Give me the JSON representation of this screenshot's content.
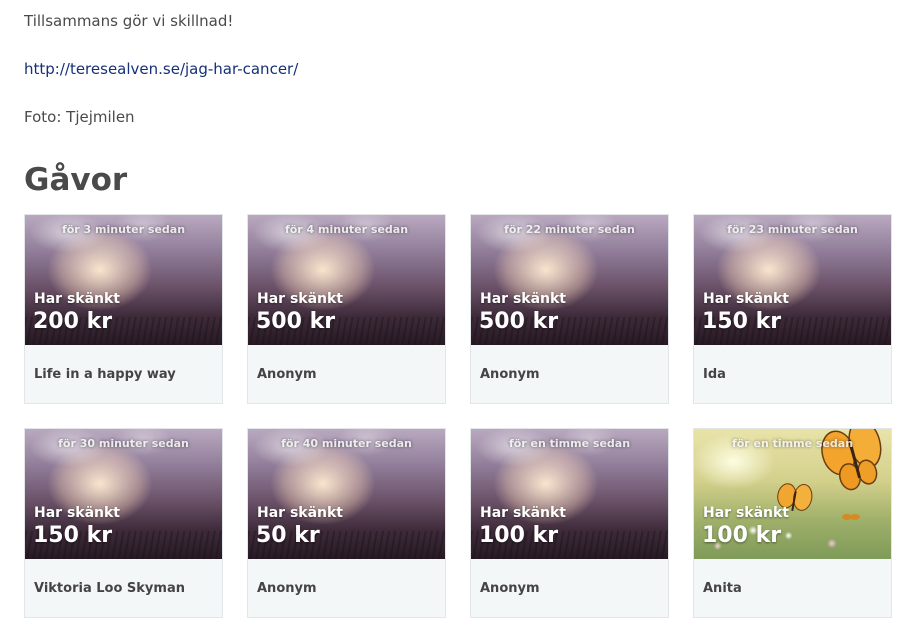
{
  "intro": {
    "tagline": "Tillsammans gör vi skillnad!",
    "link": "http://teresealven.se/jag-har-cancer/",
    "photo_credit": "Foto: Tjejmilen"
  },
  "gifts": {
    "heading": "Gåvor",
    "items": [
      {
        "time": "för 3 minuter sedan",
        "label": "Har skänkt",
        "amount": "200 kr",
        "name": "Life in a happy way",
        "image": "sunset-grass"
      },
      {
        "time": "för 4 minuter sedan",
        "label": "Har skänkt",
        "amount": "500 kr",
        "name": "Anonym",
        "image": "sunset-grass"
      },
      {
        "time": "för 22 minuter sedan",
        "label": "Har skänkt",
        "amount": "500 kr",
        "name": "Anonym",
        "image": "sunset-grass"
      },
      {
        "time": "för 23 minuter sedan",
        "label": "Har skänkt",
        "amount": "150 kr",
        "name": "Ida",
        "image": "sunset-grass"
      },
      {
        "time": "för 30 minuter sedan",
        "label": "Har skänkt",
        "amount": "150 kr",
        "name": "Viktoria Loo Skyman",
        "image": "sunset-grass"
      },
      {
        "time": "för 40 minuter sedan",
        "label": "Har skänkt",
        "amount": "50 kr",
        "name": "Anonym",
        "image": "sunset-grass"
      },
      {
        "time": "för en timme sedan",
        "label": "Har skänkt",
        "amount": "100 kr",
        "name": "Anonym",
        "image": "sunset-grass"
      },
      {
        "time": "för en timme sedan",
        "label": "Har skänkt",
        "amount": "100 kr",
        "name": "Anita",
        "image": "butterfly-meadow"
      }
    ]
  },
  "colors": {
    "text": "#4a4a4a",
    "link": "#16307a",
    "card_background": "#f4f7f8"
  }
}
